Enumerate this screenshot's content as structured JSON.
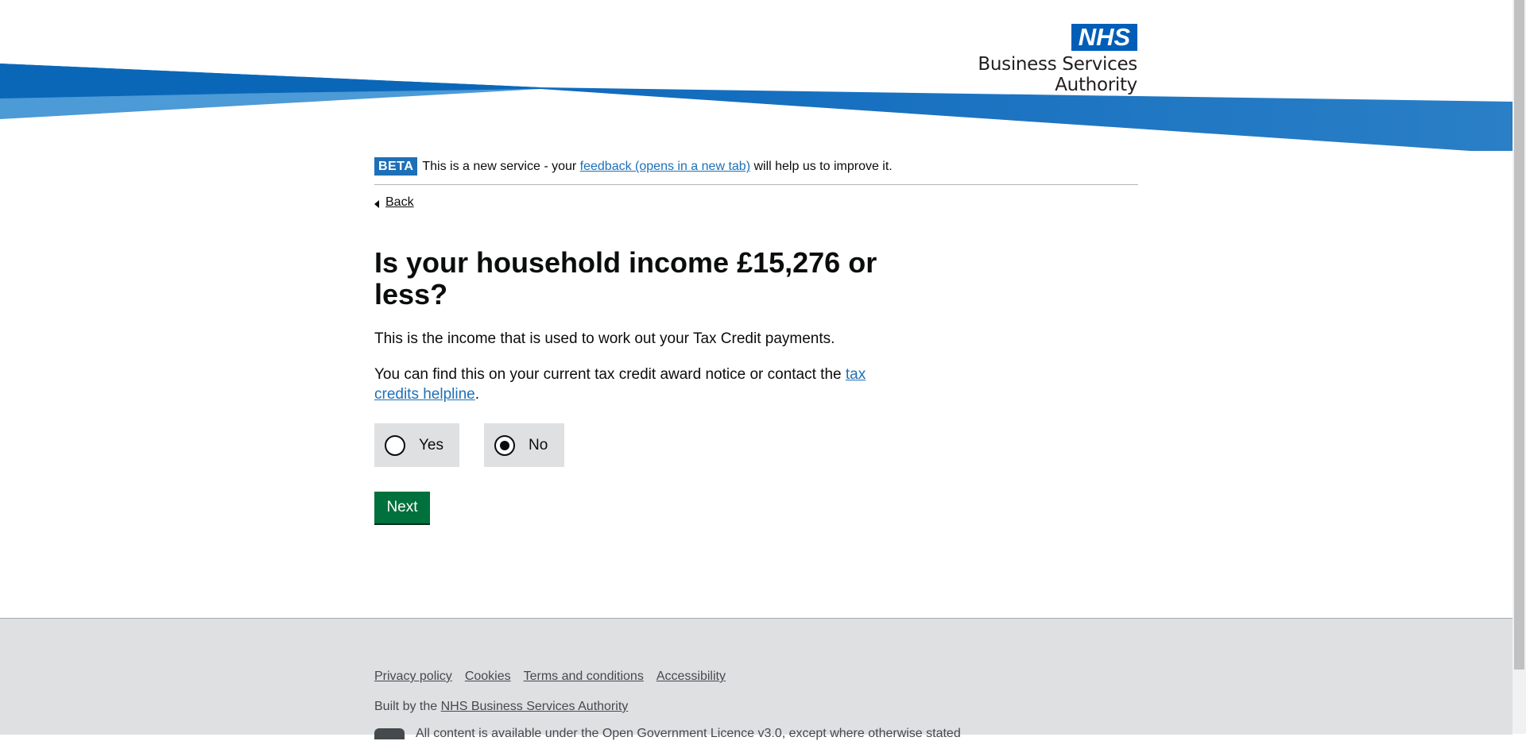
{
  "header": {
    "logo_text": "NHS",
    "org_name": "Business Services Authority"
  },
  "phase_banner": {
    "tag": "BETA",
    "text_before": "This is a new service - your ",
    "link": "feedback (opens in a new tab)",
    "text_after": " will help us to improve it."
  },
  "back_link": "Back",
  "question": {
    "heading": "Is your household income £15,276 or less?",
    "hint_1": "This is the income that is used to work out your Tax Credit payments.",
    "hint_2_before": "You can find this on your current tax credit award notice or contact the ",
    "hint_2_link": "tax credits helpline",
    "hint_2_after": "."
  },
  "options": [
    {
      "label": "Yes",
      "selected": false
    },
    {
      "label": "No",
      "selected": true
    }
  ],
  "next_button": "Next",
  "footer": {
    "links": [
      "Privacy policy",
      "Cookies",
      "Terms and conditions",
      "Accessibility"
    ],
    "built_by_text": "Built by the ",
    "built_by_link": "NHS Business Services Authority",
    "licence_text": "All content is available under the Open Government Licence v3.0, except where otherwise stated"
  },
  "colors": {
    "nhs_blue": "#005eb8",
    "link_blue": "#1d70b8",
    "button_green": "#00703c",
    "footer_grey": "#dee0e2"
  }
}
